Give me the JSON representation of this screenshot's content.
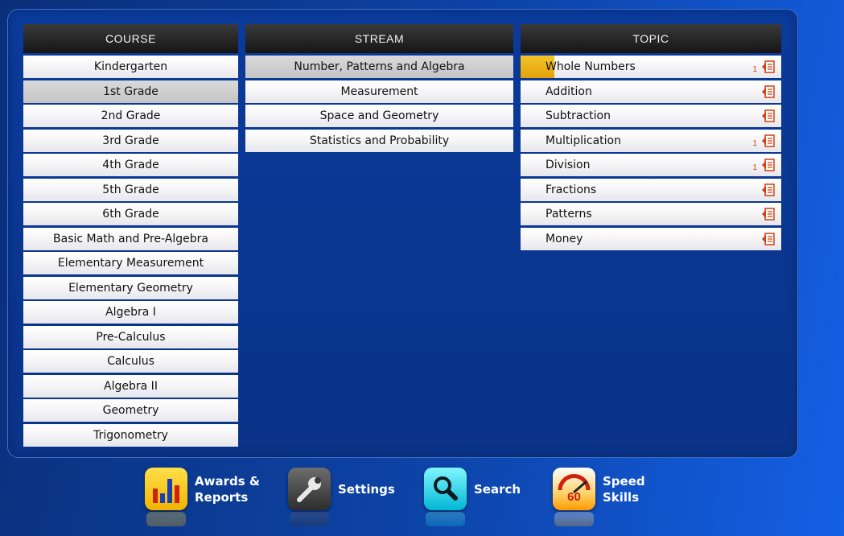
{
  "course": {
    "header": "COURSE",
    "selected": 1,
    "items": [
      "Kindergarten",
      "1st Grade",
      "2nd Grade",
      "3rd Grade",
      "4th Grade",
      "5th Grade",
      "6th Grade",
      "Basic Math and Pre-Algebra",
      "Elementary Measurement",
      "Elementary Geometry",
      "Algebra I",
      "Pre-Calculus",
      "Calculus",
      "Algebra II",
      "Geometry",
      "Trigonometry"
    ]
  },
  "stream": {
    "header": "STREAM",
    "selected": 0,
    "items": [
      "Number, Patterns and Algebra",
      "Measurement",
      "Space and Geometry",
      "Statistics and Probability"
    ]
  },
  "topic": {
    "header": "TOPIC",
    "items": [
      {
        "label": "Whole Numbers",
        "count": "1",
        "progress": 0.13,
        "icon": "worksheet-icon"
      },
      {
        "label": "Addition",
        "count": "",
        "progress": 0,
        "icon": "worksheet-icon"
      },
      {
        "label": "Subtraction",
        "count": "",
        "progress": 0,
        "icon": "worksheet-icon"
      },
      {
        "label": "Multiplication",
        "count": "1",
        "progress": 0,
        "icon": "worksheet-icon"
      },
      {
        "label": "Division",
        "count": "1",
        "progress": 0,
        "icon": "worksheet-icon"
      },
      {
        "label": "Fractions",
        "count": "",
        "progress": 0,
        "icon": "worksheet-icon"
      },
      {
        "label": "Patterns",
        "count": "",
        "progress": 0,
        "icon": "worksheet-icon"
      },
      {
        "label": "Money",
        "count": "",
        "progress": 0,
        "icon": "worksheet-icon"
      }
    ]
  },
  "dock": {
    "awards": {
      "line1": "Awards &",
      "line2": "Reports",
      "icon": "bar-chart-icon"
    },
    "settings": {
      "label": "Settings",
      "icon": "wrench-icon"
    },
    "search": {
      "label": "Search",
      "icon": "magnifier-icon"
    },
    "speed": {
      "line1": "Speed",
      "line2": "Skills",
      "badge": "60",
      "icon": "speedometer-icon"
    }
  },
  "colors": {
    "accent": "#e8a90f",
    "panel": "#0a3a9b",
    "header": "#1f1f1f",
    "count": "#d04010"
  }
}
